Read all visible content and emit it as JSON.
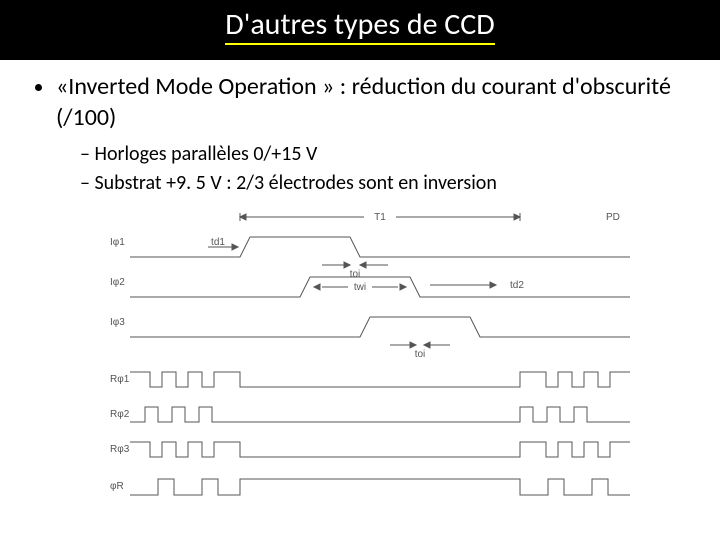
{
  "title": "D'autres types de CCD",
  "bullet1": "«Inverted Mode Operation » : réduction du courant d'obscurité (/100)",
  "sub1": "Horloges parallèles 0/+15 V",
  "sub2": "Substrat +9. 5 V : 2/3 électrodes sont en inversion",
  "sig": {
    "s1": "Iφ1",
    "s2": "Iφ2",
    "s3": "Iφ3",
    "s4": "Rφ1",
    "s5": "Rφ2",
    "s6": "Rφ3",
    "s7": "φR",
    "T1": "T1",
    "PD": "PD",
    "td1": "td1",
    "toi1": "toi",
    "twi": "twi",
    "td2": "td2",
    "toi2": "toi"
  }
}
